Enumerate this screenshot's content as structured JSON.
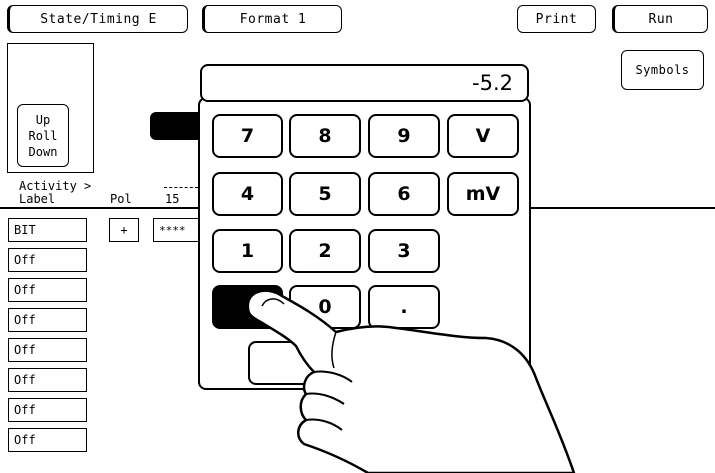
{
  "toolbar": {
    "menu1": "State/Timing E",
    "menu2": "Format 1",
    "print": "Print",
    "run": "Run",
    "symbols": "Symbols"
  },
  "roll": {
    "up": "Up",
    "roll": "Roll",
    "down": "Down"
  },
  "headers": {
    "activity": "Activity >",
    "label": "Label",
    "pol": "Pol",
    "bit15": "15"
  },
  "table": {
    "first_label": "BIT",
    "first_pol": "+",
    "first_pattern": "****",
    "rows": [
      "Off",
      "Off",
      "Off",
      "Off",
      "Off",
      "Off",
      "Off"
    ]
  },
  "keypad": {
    "display": "-5.2",
    "keys": [
      "7",
      "8",
      "9",
      "V",
      "4",
      "5",
      "6",
      "mV",
      "1",
      "2",
      "3",
      "0",
      "."
    ]
  }
}
